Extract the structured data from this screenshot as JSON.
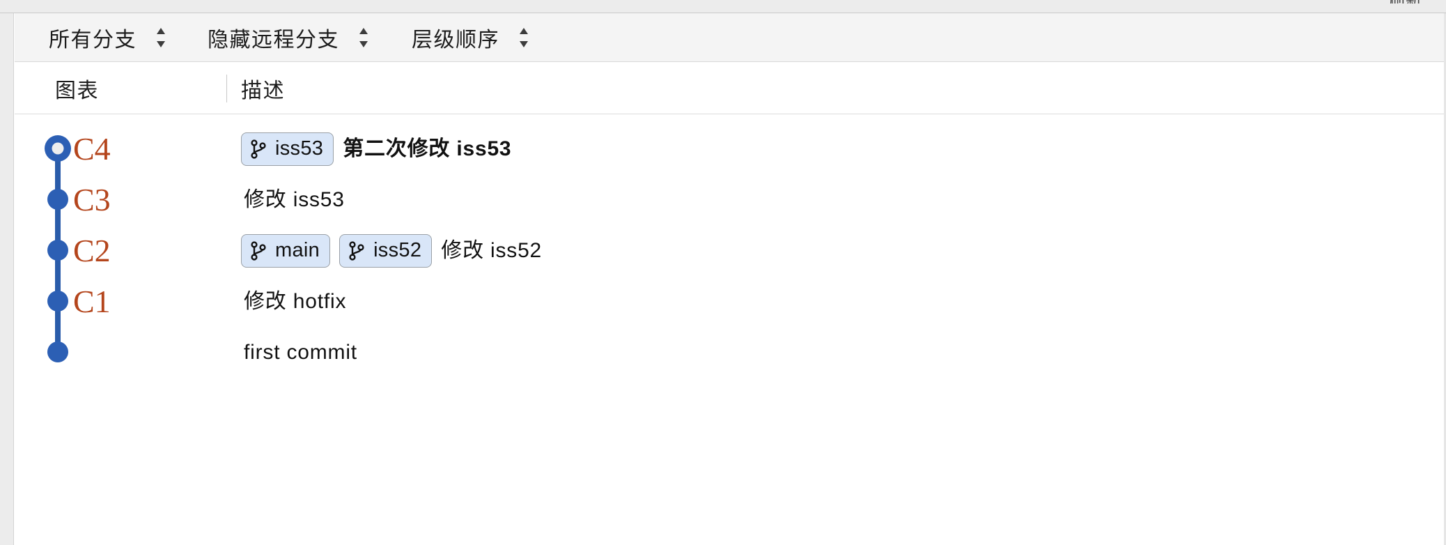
{
  "window": {
    "clipped_top_right_text": "刷新"
  },
  "toolbar": {
    "dropdowns": [
      {
        "label": "所有分支",
        "icon": "chevron-up-down-icon"
      },
      {
        "label": "隐藏远程分支",
        "icon": "chevron-up-down-icon"
      },
      {
        "label": "层级顺序",
        "icon": "chevron-up-down-icon"
      }
    ]
  },
  "table": {
    "columns": [
      {
        "label": "图表",
        "key": "graph"
      },
      {
        "label": "描述",
        "key": "description"
      }
    ],
    "rows": [
      {
        "node_label": "C4",
        "node_style": "ring",
        "refs": [
          {
            "name": "iss53",
            "icon": "git-branch-icon"
          }
        ],
        "description": "第二次修改 iss53",
        "bold": true
      },
      {
        "node_label": "C3",
        "node_style": "filled",
        "refs": [],
        "description": "修改 iss53",
        "bold": false
      },
      {
        "node_label": "C2",
        "node_style": "filled",
        "refs": [
          {
            "name": "main",
            "icon": "git-branch-icon"
          },
          {
            "name": "iss52",
            "icon": "git-branch-icon"
          }
        ],
        "description": "修改 iss52",
        "bold": false
      },
      {
        "node_label": "C1",
        "node_style": "filled",
        "refs": [],
        "description": "修改 hotfix",
        "bold": false
      },
      {
        "node_label": "",
        "node_style": "filled",
        "refs": [],
        "description": "first commit",
        "bold": false
      }
    ]
  },
  "colors": {
    "graph_line": "#2a5caa",
    "graph_node": "#2c5fb4",
    "node_ring_center": "#eeeeee",
    "commit_label": "#b4451c",
    "badge_bg": "#d9e6f8",
    "badge_border": "#9aa0a6",
    "toolbar_bg": "#f4f4f4",
    "text": "#111111"
  }
}
